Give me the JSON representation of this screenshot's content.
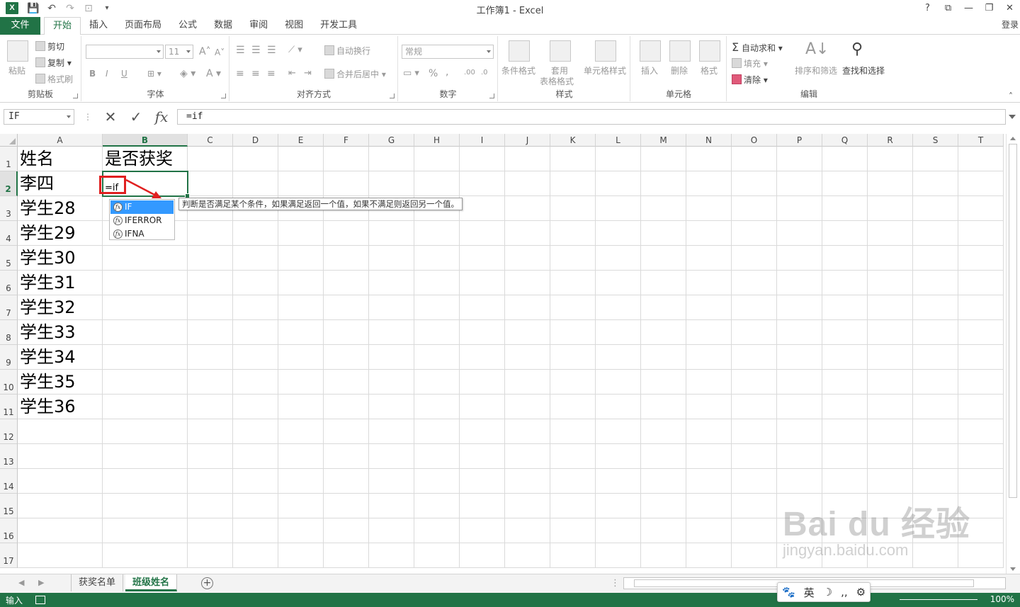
{
  "window": {
    "title": "工作簿1 - Excel",
    "logo": "X",
    "help": "?",
    "controls": [
      "?",
      "⧉",
      "—",
      "❐",
      "✕"
    ]
  },
  "tabs": {
    "file": "文件",
    "items": [
      "开始",
      "插入",
      "页面布局",
      "公式",
      "数据",
      "审阅",
      "视图",
      "开发工具"
    ],
    "active": "开始",
    "login": "登录"
  },
  "ribbon": {
    "clipboard": {
      "label": "剪贴板",
      "paste": "粘贴",
      "cut": "剪切",
      "copy": "复制",
      "format_painter": "格式刷"
    },
    "font": {
      "label": "字体",
      "size": "11",
      "bold": "B",
      "italic": "I",
      "underline": "U"
    },
    "align": {
      "label": "对齐方式",
      "wrap": "自动换行",
      "merge": "合并后居中"
    },
    "number": {
      "label": "数字",
      "format": "常规",
      "percent": "%",
      "comma": ","
    },
    "styles": {
      "label": "样式",
      "conditional": "条件格式",
      "table_line1": "套用",
      "table_line2": "表格格式",
      "cell_styles": "单元格样式"
    },
    "cells": {
      "label": "单元格",
      "insert": "插入",
      "delete": "删除",
      "format": "格式"
    },
    "editing": {
      "label": "编辑",
      "autosum": "自动求和",
      "fill": "填充",
      "clear": "清除",
      "sort": "排序和筛选",
      "find": "查找和选择"
    }
  },
  "formula_bar": {
    "name_box": "IF",
    "fx": "fx",
    "formula": "=if"
  },
  "columns": [
    "A",
    "B",
    "C",
    "D",
    "E",
    "F",
    "G",
    "H",
    "I",
    "J",
    "K",
    "L",
    "M",
    "N",
    "O",
    "P",
    "Q",
    "R",
    "S",
    "T"
  ],
  "rows": [
    "1",
    "2",
    "3",
    "4",
    "5",
    "6",
    "7",
    "8",
    "9",
    "10",
    "11",
    "12",
    "13",
    "14",
    "15",
    "16",
    "17"
  ],
  "cells": {
    "A1": "姓名",
    "B1": "是否获奖",
    "A2": "李四",
    "A3": "学生28",
    "A4": "学生29",
    "A5": "学生30",
    "A6": "学生31",
    "A7": "学生32",
    "A8": "学生33",
    "A9": "学生34",
    "A10": "学生35",
    "A11": "学生36"
  },
  "editing_cell": {
    "address": "B2",
    "text": "=if"
  },
  "autocomplete": {
    "items": [
      "IF",
      "IFERROR",
      "IFNA"
    ],
    "selected": "IF",
    "tooltip": "判断是否满足某个条件，如果满足返回一个值，如果不满足则返回另一个值。"
  },
  "sheets": {
    "items": [
      "获奖名单",
      "班级姓名"
    ],
    "active": "班级姓名",
    "add": "+"
  },
  "status": {
    "mode": "输入",
    "zoom": "100%"
  },
  "ime": {
    "lang": "英",
    "paw": "🐾",
    "moon": "☽",
    "punct": "‚,",
    "gear": "⚙"
  },
  "watermark": {
    "main": "Bai du 经验",
    "url": "jingyan.baidu.com"
  },
  "colors": {
    "accent": "#217346",
    "highlight": "#3399ff",
    "annotation": "#e02020"
  }
}
